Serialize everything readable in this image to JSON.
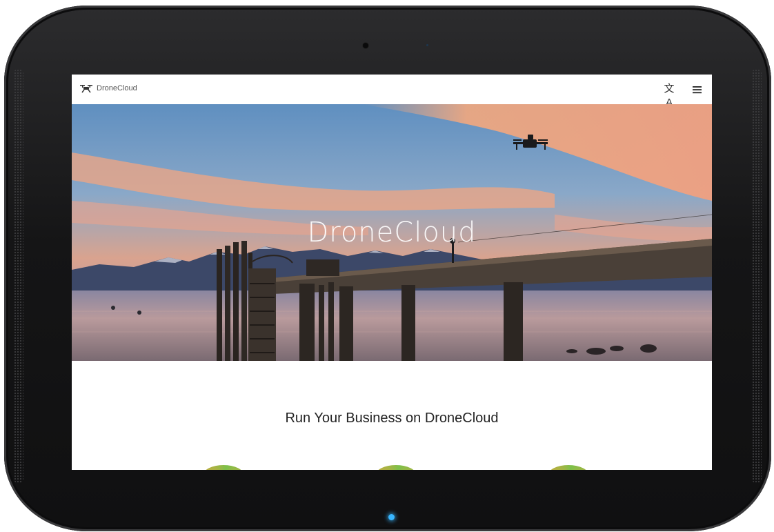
{
  "app": {
    "brand_name": "DroneCloud"
  },
  "topbar": {
    "translate_icon": "translate-icon",
    "translate_glyph": "文A",
    "menu_icon": "hamburger-menu-icon"
  },
  "hero": {
    "title": "DroneCloud"
  },
  "content": {
    "heading": "Run Your Business on DroneCloud"
  },
  "colors": {
    "device_frame": "#151516",
    "home_led": "#38b6ff",
    "sky_top": "#5f8fc0",
    "sunset_orange": "#f0a080"
  }
}
